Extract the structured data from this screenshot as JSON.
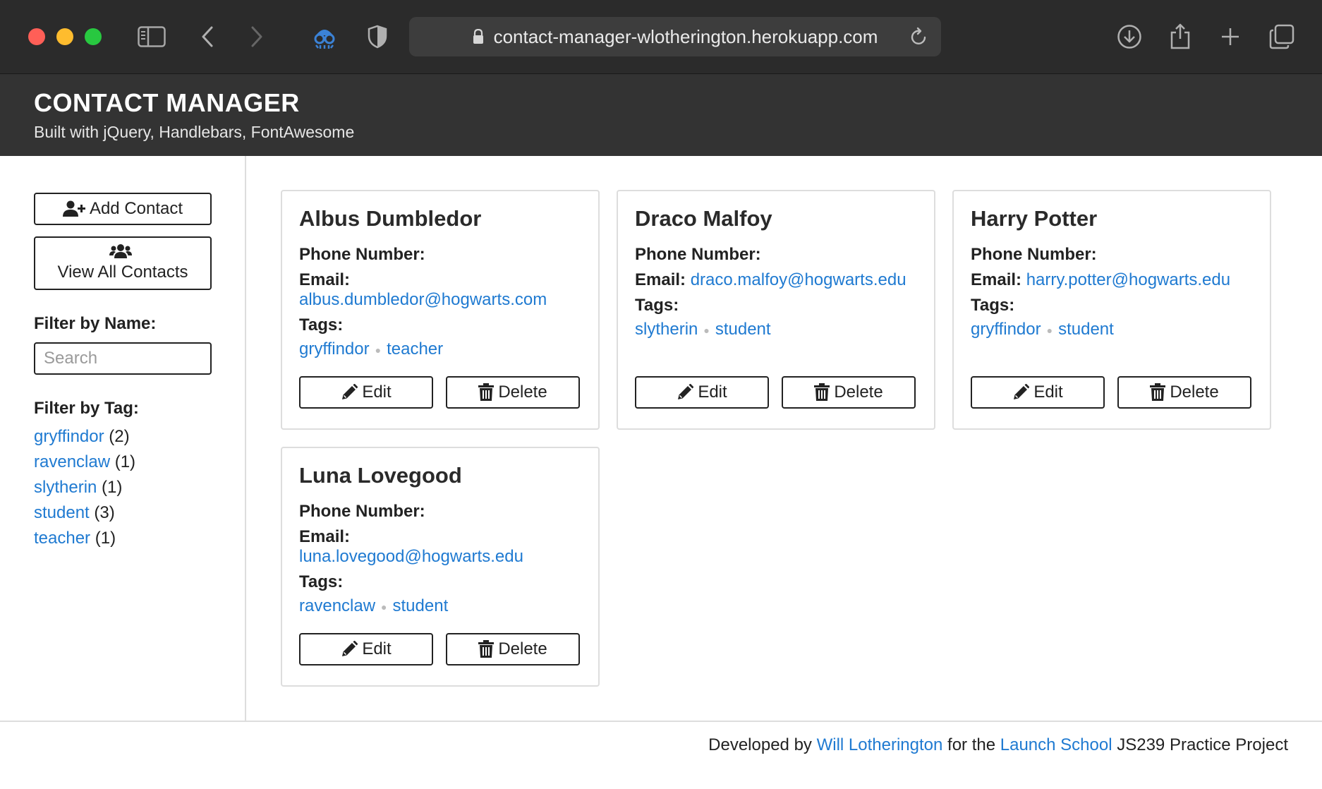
{
  "browser": {
    "url": "contact-manager-wlotherington.herokuapp.com"
  },
  "header": {
    "title": "CONTACT MANAGER",
    "subtitle": "Built with jQuery, Handlebars, FontAwesome"
  },
  "sidebar": {
    "add_contact_label": "Add Contact",
    "view_all_label": "View All Contacts",
    "filter_name_label": "Filter by Name:",
    "search_placeholder": "Search",
    "filter_tag_label": "Filter by Tag:",
    "tags": [
      {
        "name": "gryffindor",
        "count": "(2)"
      },
      {
        "name": "ravenclaw",
        "count": "(1)"
      },
      {
        "name": "slytherin",
        "count": "(1)"
      },
      {
        "name": "student",
        "count": "(3)"
      },
      {
        "name": "teacher",
        "count": "(1)"
      }
    ]
  },
  "labels": {
    "phone": "Phone Number:",
    "email": "Email:",
    "tags": "Tags:",
    "edit": "Edit",
    "delete": "Delete"
  },
  "contacts": [
    {
      "name": "Albus Dumbledor",
      "phone": "",
      "email": "albus.dumbledor@hogwarts.com",
      "tags": [
        "gryffindor",
        "teacher"
      ]
    },
    {
      "name": "Draco Malfoy",
      "phone": "",
      "email": "draco.malfoy@hogwarts.edu",
      "tags": [
        "slytherin",
        "student"
      ]
    },
    {
      "name": "Harry Potter",
      "phone": "",
      "email": "harry.potter@hogwarts.edu",
      "tags": [
        "gryffindor",
        "student"
      ]
    },
    {
      "name": "Luna Lovegood",
      "phone": "",
      "email": "luna.lovegood@hogwarts.edu",
      "tags": [
        "ravenclaw",
        "student"
      ]
    }
  ],
  "footer": {
    "prefix": "Developed by",
    "author": "Will Lotherington",
    "middle": "for the",
    "school": "Launch School",
    "suffix": "JS239 Practice Project"
  },
  "colors": {
    "link": "#1f7ad1",
    "header_bg": "#333333",
    "chrome_bg": "#2b2b2b"
  }
}
